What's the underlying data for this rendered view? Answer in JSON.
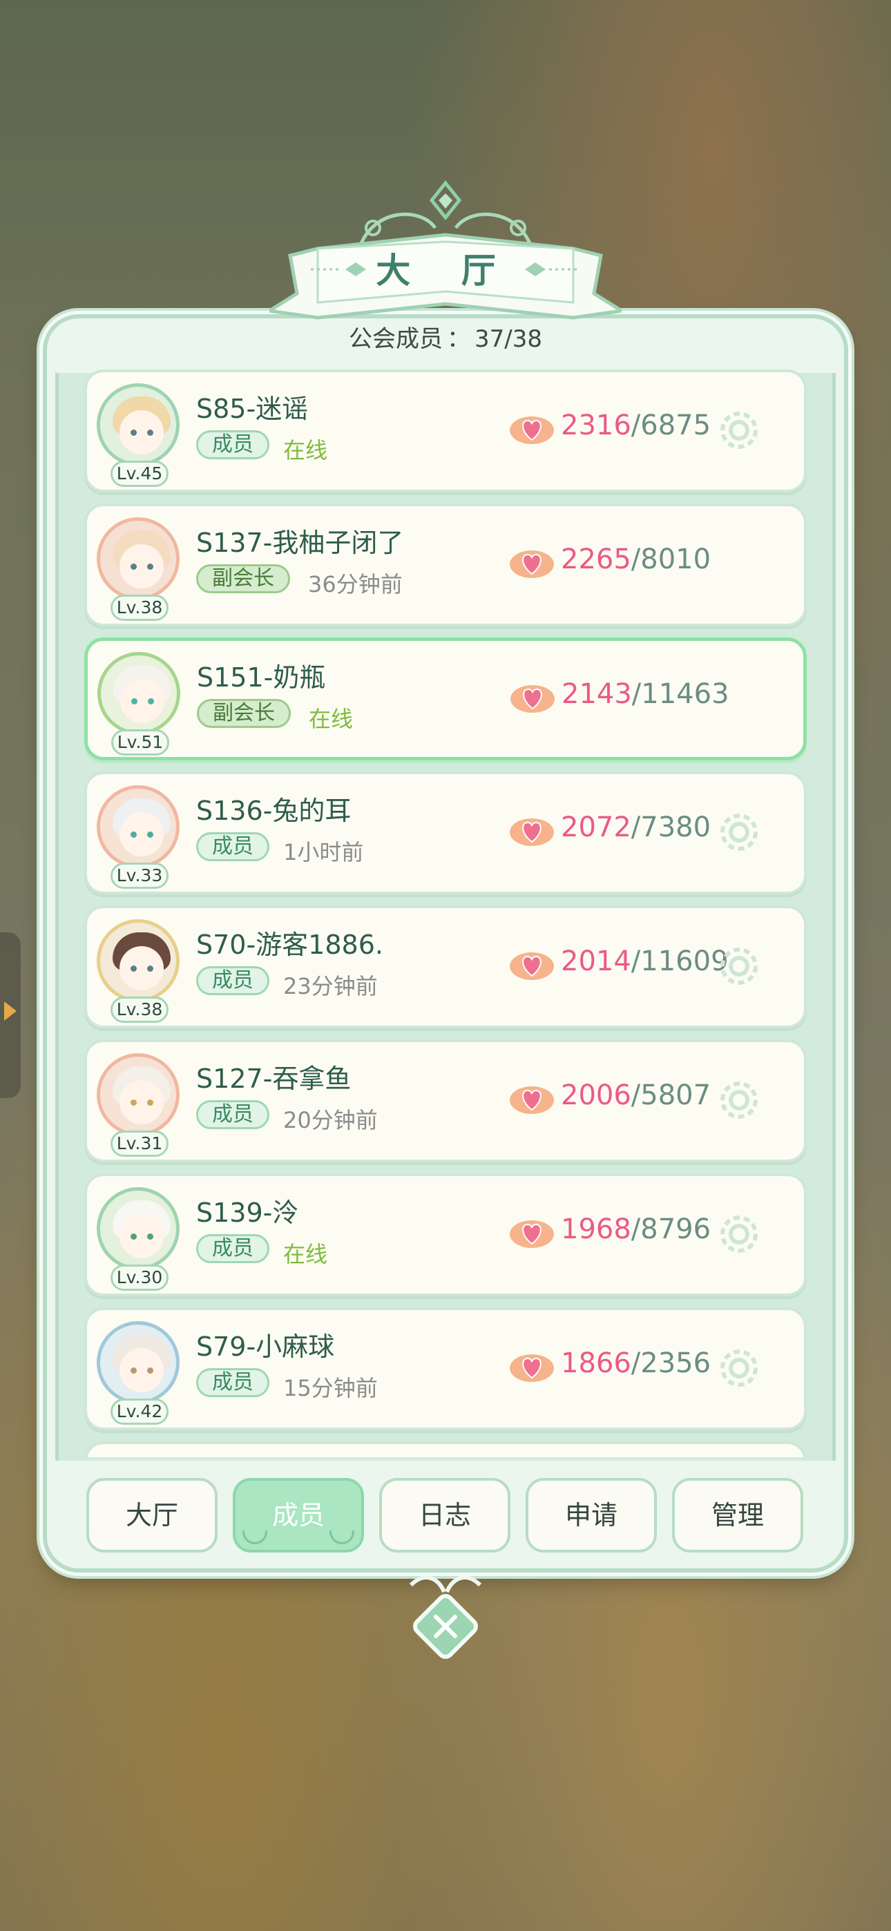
{
  "window": {
    "title": "大 厅",
    "member_count_label": "公会成员",
    "member_count_sep": "：",
    "member_count": "37/38"
  },
  "members": [
    {
      "name": "S85-迷谣",
      "level": "Lv.45",
      "role": "成员",
      "status": "在线",
      "online": true,
      "current": "2316",
      "max": "/6875",
      "gear": true
    },
    {
      "name": "S137-我柚子闭了",
      "level": "Lv.38",
      "role": "副会长",
      "status": "36分钟前",
      "online": false,
      "current": "2265",
      "max": "/8010",
      "gear": false
    },
    {
      "name": "S151-奶瓶",
      "level": "Lv.51",
      "role": "副会长",
      "status": "在线",
      "online": true,
      "current": "2143",
      "max": "/11463",
      "gear": false
    },
    {
      "name": "S136-兔的耳",
      "level": "Lv.33",
      "role": "成员",
      "status": "1小时前",
      "online": false,
      "current": "2072",
      "max": "/7380",
      "gear": true
    },
    {
      "name": "S70-游客1886.",
      "level": "Lv.38",
      "role": "成员",
      "status": "23分钟前",
      "online": false,
      "current": "2014",
      "max": "/11609",
      "gear": true
    },
    {
      "name": "S127-吞拿鱼",
      "level": "Lv.31",
      "role": "成员",
      "status": "20分钟前",
      "online": false,
      "current": "2006",
      "max": "/5807",
      "gear": true
    },
    {
      "name": "S139-泠",
      "level": "Lv.30",
      "role": "成员",
      "status": "在线",
      "online": true,
      "current": "1968",
      "max": "/8796",
      "gear": true
    },
    {
      "name": "S79-小麻球",
      "level": "Lv.42",
      "role": "成员",
      "status": "15分钟前",
      "online": false,
      "current": "1866",
      "max": "/2356",
      "gear": true
    }
  ],
  "tabs": [
    {
      "label": "大厅",
      "active": false
    },
    {
      "label": "成员",
      "active": true
    },
    {
      "label": "日志",
      "active": false
    },
    {
      "label": "申请",
      "active": false
    },
    {
      "label": "管理",
      "active": false
    }
  ],
  "icons": {
    "close": "close-icon",
    "heart": "heart-icon",
    "gear": "gear-icon",
    "side_handle": "side-arrow-icon"
  },
  "colors": {
    "accent_green": "#a9e6c1",
    "score_pink": "#ea5a86",
    "online_green": "#7fbb3e",
    "panel_bg": "#eaf6ee",
    "highlight_border": "#8fe0a5"
  }
}
